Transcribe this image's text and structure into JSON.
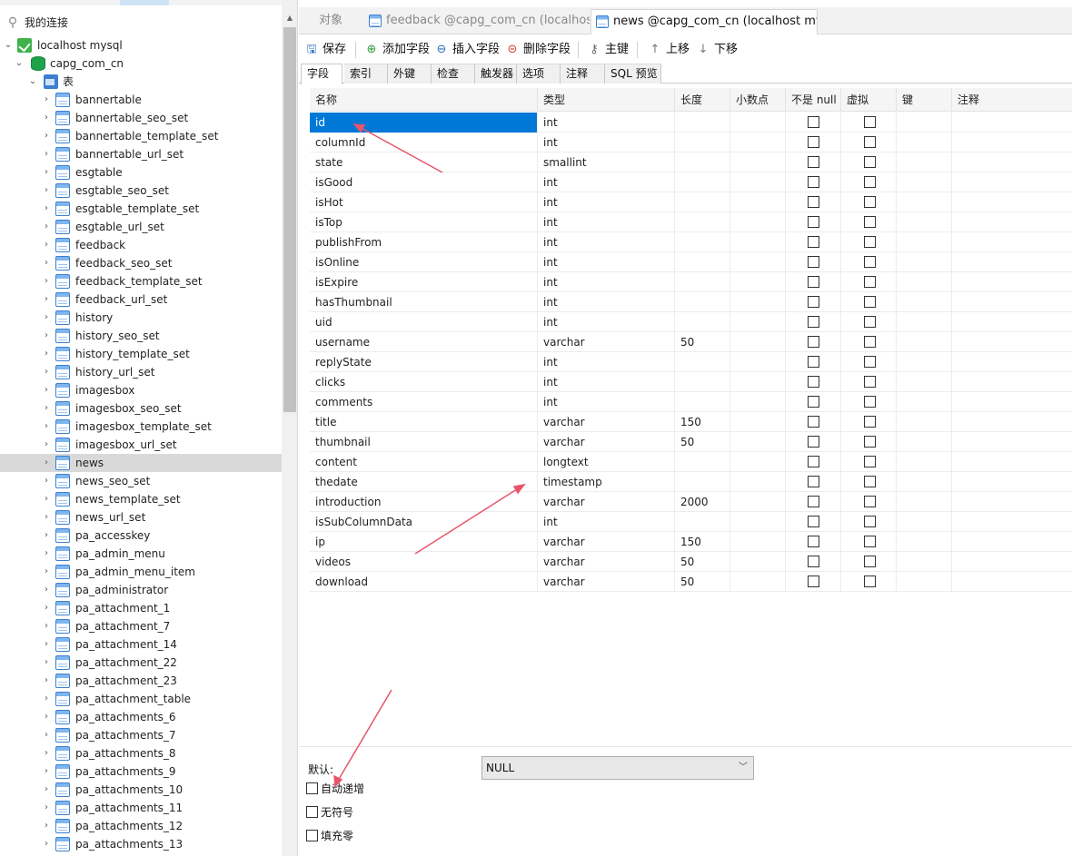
{
  "sidebar": {
    "connections_header": "我的连接",
    "connection": "localhost mysql",
    "database": "capg_com_cn",
    "tables_node": "表",
    "tables": [
      "bannertable",
      "bannertable_seo_set",
      "bannertable_template_set",
      "bannertable_url_set",
      "esgtable",
      "esgtable_seo_set",
      "esgtable_template_set",
      "esgtable_url_set",
      "feedback",
      "feedback_seo_set",
      "feedback_template_set",
      "feedback_url_set",
      "history",
      "history_seo_set",
      "history_template_set",
      "history_url_set",
      "imagesbox",
      "imagesbox_seo_set",
      "imagesbox_template_set",
      "imagesbox_url_set",
      "news",
      "news_seo_set",
      "news_template_set",
      "news_url_set",
      "pa_accesskey",
      "pa_admin_menu",
      "pa_admin_menu_item",
      "pa_administrator",
      "pa_attachment_1",
      "pa_attachment_7",
      "pa_attachment_14",
      "pa_attachment_22",
      "pa_attachment_23",
      "pa_attachment_table",
      "pa_attachments_6",
      "pa_attachments_7",
      "pa_attachments_8",
      "pa_attachments_9",
      "pa_attachments_10",
      "pa_attachments_11",
      "pa_attachments_12",
      "pa_attachments_13"
    ],
    "selected_table": "news"
  },
  "tabs": [
    {
      "label": "对象",
      "active": false
    },
    {
      "label": "feedback @capg_com_cn (localhost",
      "active": false
    },
    {
      "label": "news @capg_com_cn (localhost mys...",
      "active": true
    }
  ],
  "toolbar": {
    "save": "保存",
    "add_field": "添加字段",
    "insert_field": "插入字段",
    "delete_field": "删除字段",
    "primary_key": "主键",
    "move_up": "上移",
    "move_down": "下移"
  },
  "subtabs": [
    "字段",
    "索引",
    "外键",
    "检查",
    "触发器",
    "选项",
    "注释",
    "SQL 预览"
  ],
  "grid": {
    "headers": [
      "名称",
      "类型",
      "长度",
      "小数点",
      "不是 null",
      "虚拟",
      "键",
      "注释"
    ],
    "rows": [
      {
        "name": "id",
        "type": "int",
        "length": ""
      },
      {
        "name": "columnId",
        "type": "int",
        "length": ""
      },
      {
        "name": "state",
        "type": "smallint",
        "length": ""
      },
      {
        "name": "isGood",
        "type": "int",
        "length": ""
      },
      {
        "name": "isHot",
        "type": "int",
        "length": ""
      },
      {
        "name": "isTop",
        "type": "int",
        "length": ""
      },
      {
        "name": "publishFrom",
        "type": "int",
        "length": ""
      },
      {
        "name": "isOnline",
        "type": "int",
        "length": ""
      },
      {
        "name": "isExpire",
        "type": "int",
        "length": ""
      },
      {
        "name": "hasThumbnail",
        "type": "int",
        "length": ""
      },
      {
        "name": "uid",
        "type": "int",
        "length": ""
      },
      {
        "name": "username",
        "type": "varchar",
        "length": "50"
      },
      {
        "name": "replyState",
        "type": "int",
        "length": ""
      },
      {
        "name": "clicks",
        "type": "int",
        "length": ""
      },
      {
        "name": "comments",
        "type": "int",
        "length": ""
      },
      {
        "name": "title",
        "type": "varchar",
        "length": "150"
      },
      {
        "name": "thumbnail",
        "type": "varchar",
        "length": "50"
      },
      {
        "name": "content",
        "type": "longtext",
        "length": ""
      },
      {
        "name": "thedate",
        "type": "timestamp",
        "length": ""
      },
      {
        "name": "introduction",
        "type": "varchar",
        "length": "2000"
      },
      {
        "name": "isSubColumnData",
        "type": "int",
        "length": ""
      },
      {
        "name": "ip",
        "type": "varchar",
        "length": "150"
      },
      {
        "name": "videos",
        "type": "varchar",
        "length": "50"
      },
      {
        "name": "download",
        "type": "varchar",
        "length": "50"
      }
    ],
    "selected_row": "id"
  },
  "bottom": {
    "default_label": "默认:",
    "default_value": "NULL",
    "auto_increment": "自动递增",
    "unsigned": "无符号",
    "zerofill": "填充零"
  },
  "colors": {
    "selection": "#0078d7",
    "annotation_arrow": "#e8556b"
  }
}
